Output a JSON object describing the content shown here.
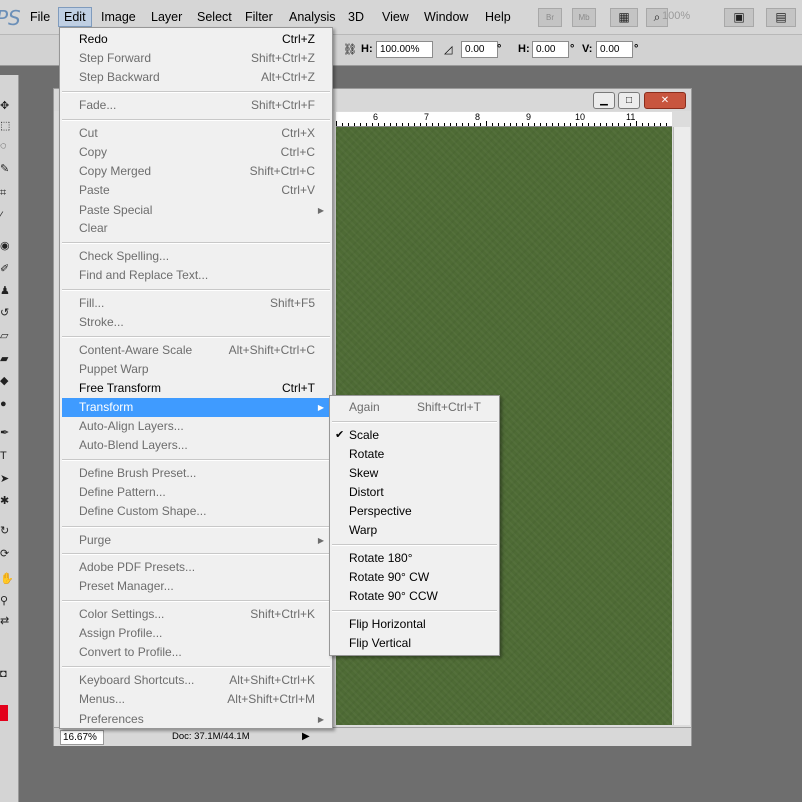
{
  "app": {
    "logo_text": "PS"
  },
  "menubar": {
    "items": [
      "File",
      "Edit",
      "Image",
      "Layer",
      "Select",
      "Filter",
      "Analysis",
      "3D",
      "View",
      "Window",
      "Help"
    ],
    "active": "Edit",
    "icon_br": "Br",
    "icon_mb": "Mb",
    "zoom": "100%"
  },
  "options": {
    "h_label": "H:",
    "h_value": "100.00%",
    "angle_value": "0.00",
    "hskew_label": "H:",
    "hskew_value": "0.00",
    "vskew_label": "V:",
    "vskew_value": "0.00",
    "degree": "°"
  },
  "document": {
    "ruler_numbers": [
      "6",
      "7",
      "8",
      "9",
      "10",
      "11"
    ],
    "zoom": "16.67%",
    "doc_info": "Doc: 37.1M/44.1M",
    "canvas_color": "#4e6b35"
  },
  "edit_menu": {
    "items": [
      {
        "label": "Redo",
        "shortcut": "Ctrl+Z",
        "enabled": true
      },
      {
        "label": "Step Forward",
        "shortcut": "Shift+Ctrl+Z",
        "enabled": false
      },
      {
        "label": "Step Backward",
        "shortcut": "Alt+Ctrl+Z",
        "enabled": false
      },
      {
        "label": "Fade...",
        "shortcut": "Shift+Ctrl+F",
        "enabled": false
      },
      {
        "label": "Cut",
        "shortcut": "Ctrl+X",
        "enabled": false
      },
      {
        "label": "Copy",
        "shortcut": "Ctrl+C",
        "enabled": false
      },
      {
        "label": "Copy Merged",
        "shortcut": "Shift+Ctrl+C",
        "enabled": false
      },
      {
        "label": "Paste",
        "shortcut": "Ctrl+V",
        "enabled": false
      },
      {
        "label": "Paste Special",
        "shortcut": "",
        "enabled": false,
        "submenu": true
      },
      {
        "label": "Clear",
        "shortcut": "",
        "enabled": false
      },
      {
        "label": "Check Spelling...",
        "shortcut": "",
        "enabled": false
      },
      {
        "label": "Find and Replace Text...",
        "shortcut": "",
        "enabled": false
      },
      {
        "label": "Fill...",
        "shortcut": "Shift+F5",
        "enabled": false
      },
      {
        "label": "Stroke...",
        "shortcut": "",
        "enabled": false
      },
      {
        "label": "Content-Aware Scale",
        "shortcut": "Alt+Shift+Ctrl+C",
        "enabled": false
      },
      {
        "label": "Puppet Warp",
        "shortcut": "",
        "enabled": false
      },
      {
        "label": "Free Transform",
        "shortcut": "Ctrl+T",
        "enabled": true
      },
      {
        "label": "Transform",
        "shortcut": "",
        "enabled": true,
        "submenu": true,
        "highlighted": true
      },
      {
        "label": "Auto-Align Layers...",
        "shortcut": "",
        "enabled": false
      },
      {
        "label": "Auto-Blend Layers...",
        "shortcut": "",
        "enabled": false
      },
      {
        "label": "Define Brush Preset...",
        "shortcut": "",
        "enabled": false
      },
      {
        "label": "Define Pattern...",
        "shortcut": "",
        "enabled": false
      },
      {
        "label": "Define Custom Shape...",
        "shortcut": "",
        "enabled": false
      },
      {
        "label": "Purge",
        "shortcut": "",
        "enabled": false,
        "submenu": true
      },
      {
        "label": "Adobe PDF Presets...",
        "shortcut": "",
        "enabled": false
      },
      {
        "label": "Preset Manager...",
        "shortcut": "",
        "enabled": false
      },
      {
        "label": "Color Settings...",
        "shortcut": "Shift+Ctrl+K",
        "enabled": false
      },
      {
        "label": "Assign Profile...",
        "shortcut": "",
        "enabled": false
      },
      {
        "label": "Convert to Profile...",
        "shortcut": "",
        "enabled": false
      },
      {
        "label": "Keyboard Shortcuts...",
        "shortcut": "Alt+Shift+Ctrl+K",
        "enabled": false
      },
      {
        "label": "Menus...",
        "shortcut": "Alt+Shift+Ctrl+M",
        "enabled": false
      },
      {
        "label": "Preferences",
        "shortcut": "",
        "enabled": false,
        "submenu": true
      }
    ]
  },
  "transform_menu": {
    "items": [
      {
        "label": "Again",
        "shortcut": "Shift+Ctrl+T",
        "enabled": false,
        "checked": false
      },
      {
        "label": "Scale",
        "shortcut": "",
        "enabled": true,
        "checked": true
      },
      {
        "label": "Rotate",
        "shortcut": "",
        "enabled": true,
        "checked": false
      },
      {
        "label": "Skew",
        "shortcut": "",
        "enabled": true,
        "checked": false
      },
      {
        "label": "Distort",
        "shortcut": "",
        "enabled": true,
        "checked": false
      },
      {
        "label": "Perspective",
        "shortcut": "",
        "enabled": true,
        "checked": false
      },
      {
        "label": "Warp",
        "shortcut": "",
        "enabled": true,
        "checked": false
      },
      {
        "label": "Rotate 180°",
        "shortcut": "",
        "enabled": true,
        "checked": false
      },
      {
        "label": "Rotate 90° CW",
        "shortcut": "",
        "enabled": true,
        "checked": false
      },
      {
        "label": "Rotate 90° CCW",
        "shortcut": "",
        "enabled": true,
        "checked": false
      },
      {
        "label": "Flip Horizontal",
        "shortcut": "",
        "enabled": true,
        "checked": false
      },
      {
        "label": "Flip Vertical",
        "shortcut": "",
        "enabled": true,
        "checked": false
      }
    ]
  },
  "colors": {
    "highlight": "#3f9bff",
    "foreground_swatch": "#e3001b",
    "background_swatch": "#0c0c0c"
  }
}
